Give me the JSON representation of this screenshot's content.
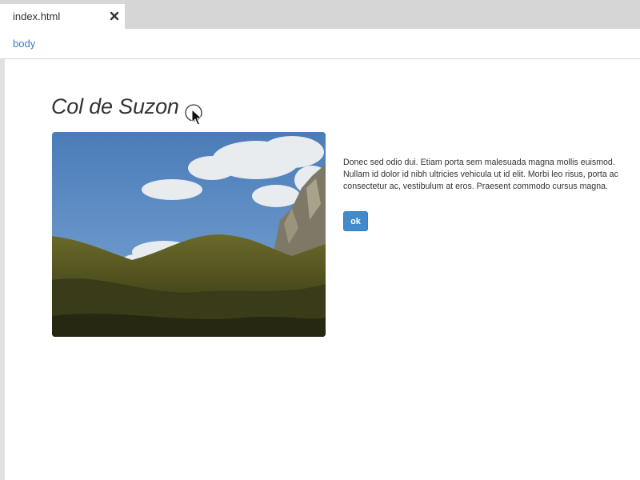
{
  "tabs": [
    {
      "label": "index.html",
      "close_icon": "close-icon"
    }
  ],
  "breadcrumb": {
    "items": [
      "body"
    ]
  },
  "content": {
    "heading": "Col de Suzon",
    "image_icon": "landscape-photo",
    "description": "Donec sed odio dui. Etiam porta sem malesuada magna mollis euismod. Nullam id dolor id nibh ultricies vehicula ut id elit. Morbi leo risus, porta ac consectetur ac, vestibulum at eros. Praesent commodo cursus magna.",
    "button_label": "ok"
  },
  "colors": {
    "accent": "#428bca",
    "link": "#3a7bbf",
    "text": "#333333",
    "chrome": "#d6d6d6"
  }
}
